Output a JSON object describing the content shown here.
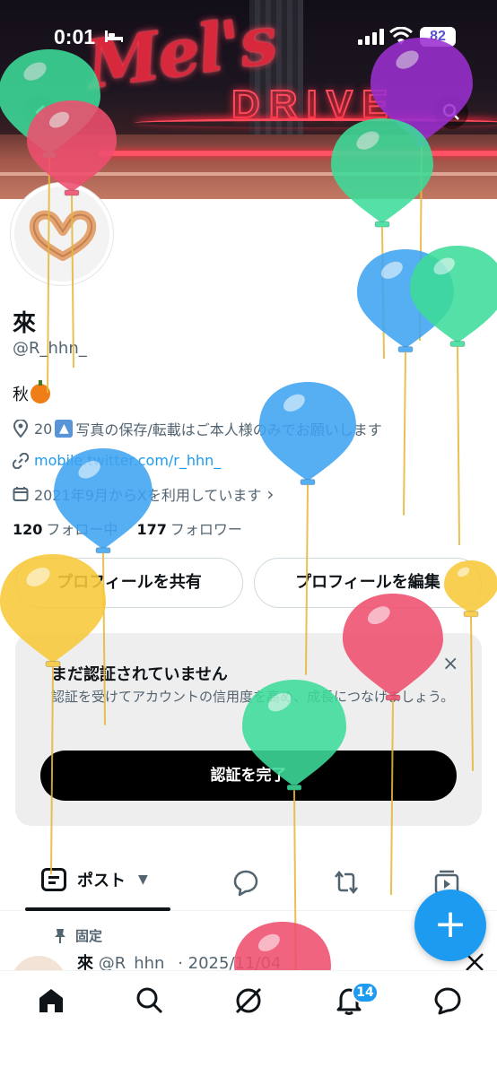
{
  "status_bar": {
    "time": "0:01",
    "battery": "82"
  },
  "profile": {
    "name": "來",
    "handle": "@R_hhn_",
    "bio": "秋",
    "location_prefix": "20",
    "location_suffix": "写真の保存/転載はご本人様のみでお願いします",
    "website": "mobile.twitter.com/r_hhn_",
    "joined": "2021年9月からXを利用しています",
    "joined_chevron": "›",
    "following_count": "120",
    "following_label": "フォロー中",
    "followers_count": "177",
    "followers_label": "フォロワー"
  },
  "actions": {
    "share_profile": "プロフィールを共有",
    "edit_profile": "プロフィールを編集"
  },
  "verification_card": {
    "title": "まだ認証されていません",
    "description": "認証を受けてアカウントの信用度を高め、成長につなげましょう。",
    "button": "認証を完了",
    "close": "×"
  },
  "tabs": {
    "posts_label": "ポスト"
  },
  "pinned_post": {
    "pinned_label": "固定",
    "author_name": "來",
    "author_handle": "@R_hhn_",
    "date": "· 2025/11/04"
  },
  "fab": {
    "label": "+"
  },
  "notifications": {
    "badge": "14"
  },
  "colors": {
    "accent": "#1d9bf0",
    "text_primary": "#0f1419",
    "text_secondary": "#536471",
    "balloon_green": "#3ddc9a",
    "balloon_red": "#ef4f6f",
    "balloon_purple": "#9a2fd0",
    "balloon_blue": "#3fa3f2",
    "balloon_yellow": "#f8c93a"
  },
  "icons": [
    "bed-icon",
    "signal-icon",
    "wifi-icon",
    "back-icon",
    "search-icon",
    "more-icon",
    "location-icon",
    "link-icon",
    "calendar-icon",
    "post-icon",
    "reply-icon",
    "repost-icon",
    "media-icon",
    "pin-icon",
    "home-icon",
    "grok-icon",
    "bell-icon",
    "messages-icon",
    "x-logo-icon",
    "balloon-icon"
  ]
}
